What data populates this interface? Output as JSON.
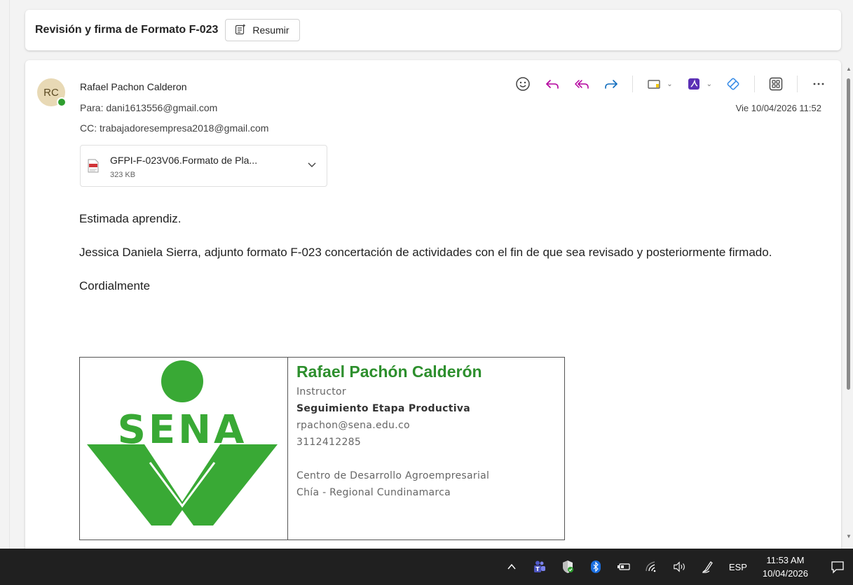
{
  "subject": {
    "title": "Revisión y firma de Formato F-023",
    "summarize_label": "Resumir"
  },
  "message": {
    "avatar_initials": "RC",
    "sender": "Rafael Pachon Calderon",
    "to_label": "Para:",
    "to": "dani1613556@gmail.com",
    "cc_label": "CC:",
    "cc": "trabajadoresempresa2018@gmail.com",
    "date": "Vie 10/04/2026 11:52",
    "toolbar_icons": [
      "emoji-icon",
      "reply-icon",
      "reply-all-icon",
      "forward-icon",
      "mark-icon",
      "pdf-icon",
      "apps-icon",
      "grid-icon",
      "more-icon"
    ],
    "attachment": {
      "name": "GFPI-F-023V06.Formato de Pla...",
      "size": "323 KB",
      "type_icon": "pdf-file-icon"
    },
    "body": {
      "greeting": "Estimada aprendiz.",
      "paragraph": "Jessica Daniela Sierra, adjunto formato F-023 concertación de actividades con el fin de que sea revisado y posteriormente firmado.",
      "closing": "Cordialmente"
    },
    "signature": {
      "logo_text": "SENA",
      "name": "Rafael Pachón Calderón",
      "role": "Instructor",
      "role2": "Seguimiento Etapa Productiva",
      "email": "rpachon@sena.edu.co",
      "phone": "3112412285",
      "center": "Centro de Desarrollo Agroempresarial",
      "region": "Chía - Regional Cundinamarca"
    }
  },
  "taskbar": {
    "language": "ESP",
    "time": "11:53 AM",
    "date": "10/04/2026"
  },
  "colors": {
    "accent": "#0f6cbd",
    "sena_green": "#39a935",
    "presence": "#2e9e2e",
    "taskbar": "#202020"
  }
}
